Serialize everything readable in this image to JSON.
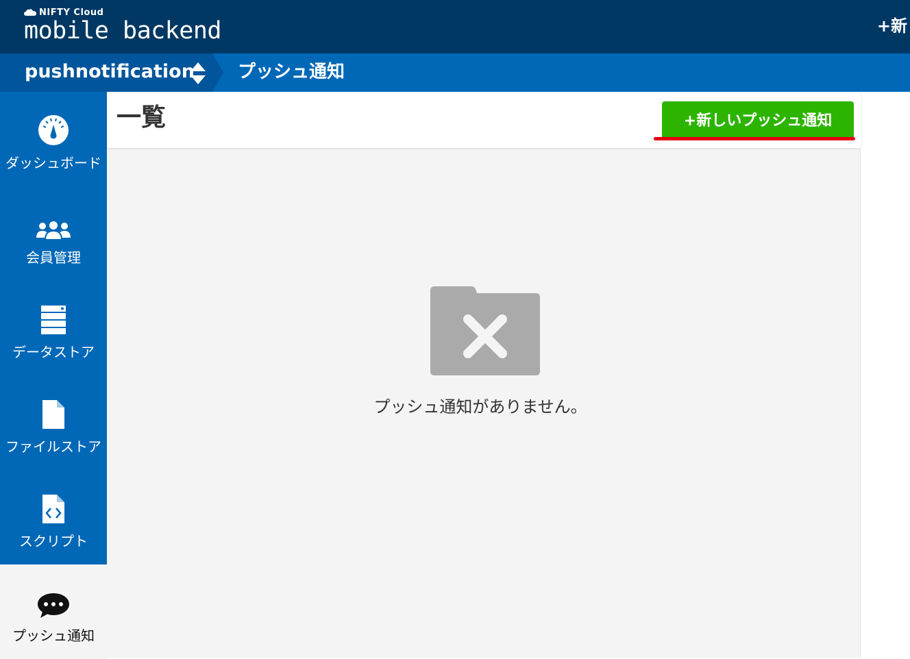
{
  "header": {
    "brand_small": "NIFTY Cloud",
    "brand_main": "mobile backend",
    "new_label": "+新"
  },
  "appbar": {
    "app_name": "pushnotification",
    "breadcrumb": "プッシュ通知"
  },
  "sidebar": {
    "items": [
      {
        "label": "ダッシュボード",
        "icon": "dashboard-gauge-icon"
      },
      {
        "label": "会員管理",
        "icon": "members-icon"
      },
      {
        "label": "データストア",
        "icon": "database-icon"
      },
      {
        "label": "ファイルストア",
        "icon": "file-icon"
      },
      {
        "label": "スクリプト",
        "icon": "script-icon"
      },
      {
        "label": "プッシュ通知",
        "icon": "chat-bubble-icon",
        "active": true
      }
    ]
  },
  "main": {
    "title": "一覧",
    "new_button_label": "+新しいプッシュ通知",
    "empty_message": "プッシュ通知がありません。"
  },
  "colors": {
    "header_bg": "#003863",
    "appbar_bg": "#0068b7",
    "sidebar_bg": "#0068b7",
    "button_green": "#2db400",
    "highlight_red": "#e60012"
  }
}
